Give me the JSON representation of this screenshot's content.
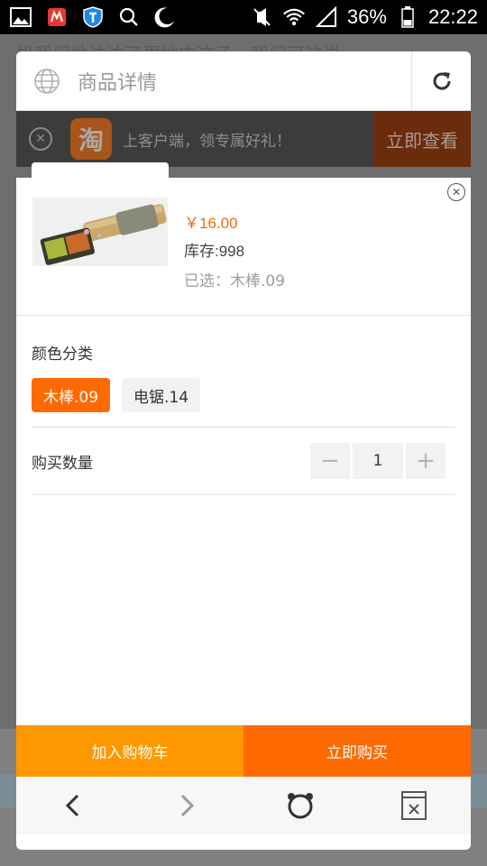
{
  "status_bar": {
    "battery": "36%",
    "time": "22:22"
  },
  "background_page": {
    "text": "机我们地达达了更地中这子，我们可这说"
  },
  "header": {
    "title": "商品详情"
  },
  "banner": {
    "logo_text": "淘",
    "text": "上客户端，领专属好礼！",
    "button": "立即查看"
  },
  "product": {
    "price": "￥16.00",
    "stock": "库存:998",
    "selected": "已选：木棒.09"
  },
  "sku": {
    "title": "颜色分类",
    "options": [
      {
        "label": "木棒.09",
        "active": true
      },
      {
        "label": "电锯.14",
        "active": false
      }
    ]
  },
  "quantity": {
    "label": "购买数量",
    "value": "1"
  },
  "actions": {
    "add_to_cart": "加入购物车",
    "buy_now": "立即购买"
  },
  "colors": {
    "accent_orange": "#ff6a00",
    "cart_orange": "#ff9800",
    "price_color": "#f26c09"
  },
  "icons": {
    "header_left": "globe-icon",
    "header_right": "refresh-icon",
    "banner_close": "close-circle-icon",
    "dialog_close": "close-circle-icon",
    "nav_back": "chevron-left-icon",
    "nav_forward": "chevron-right-icon",
    "nav_home": "bear-icon",
    "nav_close": "close-window-icon"
  }
}
